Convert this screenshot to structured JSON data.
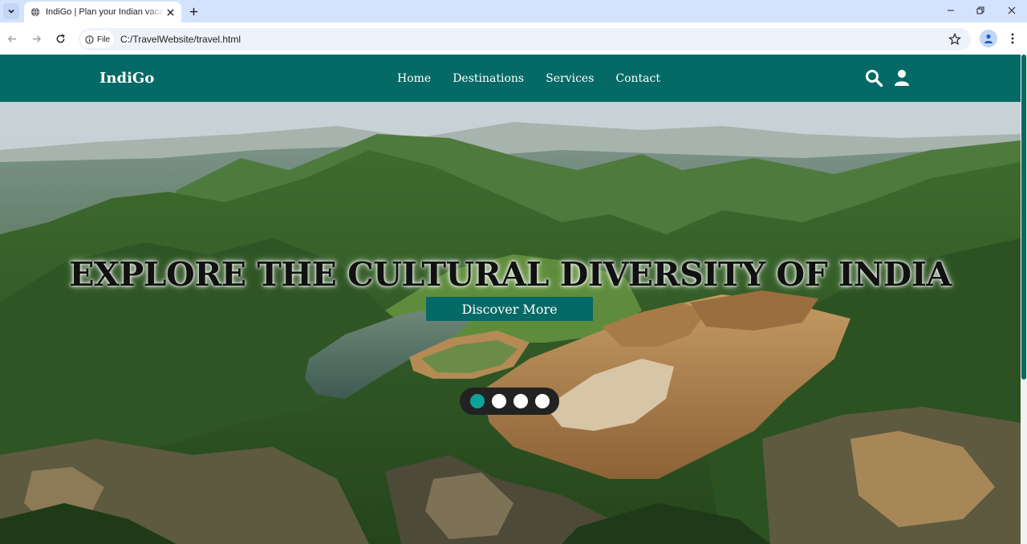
{
  "browser": {
    "tab_title": "IndiGo | Plan your Indian vacation",
    "site_chip_label": "File",
    "url": "C:/TravelWebsite/travel.html"
  },
  "site": {
    "logo": "IndiGo",
    "nav": [
      "Home",
      "Destinations",
      "Services",
      "Contact"
    ],
    "hero_title": "EXPLORE THE CULTURAL DIVERSITY OF INDIA",
    "cta_label": "Discover More",
    "carousel": {
      "total_slides": 4,
      "active_index": 0
    }
  },
  "colors": {
    "brand": "#056a66",
    "active_dot": "#0aa39b"
  },
  "icons": {
    "search": "search-icon",
    "user": "user-icon",
    "star": "star-icon",
    "profile": "profile-icon"
  }
}
